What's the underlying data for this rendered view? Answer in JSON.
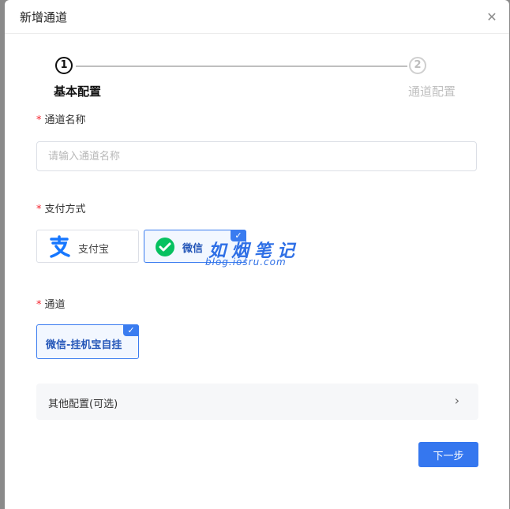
{
  "dialog": {
    "title": "新增通道",
    "close_icon": "close-icon"
  },
  "steps": [
    {
      "number": "1",
      "label": "基本配置",
      "state": "active"
    },
    {
      "number": "2",
      "label": "通道配置",
      "state": "inactive"
    }
  ],
  "form": {
    "channel_name": {
      "required_mark": "*",
      "label": "通道名称",
      "value": "",
      "placeholder": "请输入通道名称"
    },
    "payment_method": {
      "required_mark": "*",
      "label": "支付方式",
      "options": [
        {
          "label": "支付宝",
          "icon": "alipay-icon",
          "selected": false
        },
        {
          "label": "微信",
          "icon": "wechat-pay-icon",
          "selected": true
        }
      ]
    },
    "channel": {
      "required_mark": "*",
      "label": "通道",
      "options": [
        {
          "label": "微信-挂机宝自挂",
          "selected": true
        }
      ]
    }
  },
  "watermark": {
    "title": "如烟笔记",
    "url": "blog.iosru.com"
  },
  "other_config": {
    "label": "其他配置(可选)",
    "icon": "chevron-right-icon"
  },
  "footer": {
    "next_label": "下一步"
  },
  "colors": {
    "primary": "#3577ef",
    "required": "#f5222d",
    "alipay": "#1677ff",
    "wechat": "#07c160"
  }
}
